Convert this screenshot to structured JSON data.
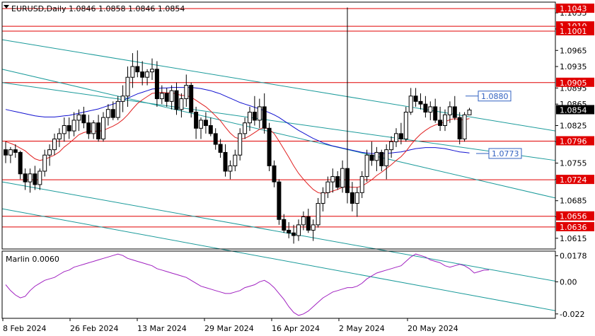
{
  "header": {
    "symbol": "EURUSD,Daily",
    "ohlc": "1.0846 1.0858 1.0846 1.0854"
  },
  "chart_data": [
    {
      "type": "candlestick",
      "title": "EURUSD,Daily  1.0846 1.0858 1.0846 1.0854",
      "x_tick_labels": [
        "8 Feb 2024",
        "26 Feb 2024",
        "13 Mar 2024",
        "29 Mar 2024",
        "16 Apr 2024",
        "2 May 2024",
        "20 May 2024"
      ],
      "y_tick_labels": [
        "1.0615",
        "1.0655",
        "1.0685",
        "1.0725",
        "1.0755",
        "1.0795",
        "1.0825",
        "1.0865",
        "1.0895",
        "1.0935",
        "1.0965",
        "1.1005",
        "1.1035"
      ],
      "ylim": [
        1.0595,
        1.1055
      ],
      "current_price": 1.0854,
      "horizontal_levels": [
        {
          "value": 1.1043,
          "label": "1.1043"
        },
        {
          "value": 1.101,
          "label": "1.1010"
        },
        {
          "value": 1.1001,
          "label": "1.1001"
        },
        {
          "value": 1.0905,
          "label": "1.0905"
        },
        {
          "value": 1.0796,
          "label": "1.0796"
        },
        {
          "value": 1.0724,
          "label": "1.0724"
        },
        {
          "value": 1.0656,
          "label": "1.0656"
        },
        {
          "value": 1.0636,
          "label": "1.0636"
        }
      ],
      "annotations": [
        {
          "value": 1.088,
          "label": "1.0880"
        },
        {
          "value": 1.0773,
          "label": "1.0773"
        }
      ],
      "colors": {
        "level": "#e00000",
        "channel": "#1a9a9a",
        "ma_fast": "#e02020",
        "ma_slow": "#1010d0",
        "oscillator": "#a020c0",
        "label_box": "#3060c0"
      },
      "candles": [
        [
          1.078,
          1.0795,
          1.0755,
          1.077
        ],
        [
          1.077,
          1.0785,
          1.0755,
          1.078
        ],
        [
          1.078,
          1.079,
          1.0765,
          1.0775
        ],
        [
          1.0775,
          1.0778,
          1.0725,
          1.0735
        ],
        [
          1.0735,
          1.0745,
          1.0705,
          1.072
        ],
        [
          1.072,
          1.0745,
          1.07,
          1.0735
        ],
        [
          1.0735,
          1.075,
          1.0705,
          1.0715
        ],
        [
          1.0715,
          1.0745,
          1.0705,
          1.074
        ],
        [
          1.074,
          1.078,
          1.073,
          1.077
        ],
        [
          1.077,
          1.079,
          1.075,
          1.078
        ],
        [
          1.078,
          1.081,
          1.077,
          1.08
        ],
        [
          1.08,
          1.082,
          1.0785,
          1.081
        ],
        [
          1.081,
          1.084,
          1.0795,
          1.0825
        ],
        [
          1.0825,
          1.084,
          1.08,
          1.0815
        ],
        [
          1.0815,
          1.085,
          1.0805,
          1.0835
        ],
        [
          1.0835,
          1.0855,
          1.0815,
          1.0845
        ],
        [
          1.0845,
          1.086,
          1.082,
          1.083
        ],
        [
          1.083,
          1.0845,
          1.08,
          1.081
        ],
        [
          1.081,
          1.0835,
          1.08,
          1.083
        ],
        [
          1.083,
          1.0845,
          1.0795,
          1.08
        ],
        [
          1.08,
          1.085,
          1.0795,
          1.084
        ],
        [
          1.084,
          1.0865,
          1.0825,
          1.0855
        ],
        [
          1.0855,
          1.087,
          1.0835,
          1.084
        ],
        [
          1.084,
          1.088,
          1.0835,
          1.087
        ],
        [
          1.087,
          1.09,
          1.085,
          1.088
        ],
        [
          1.088,
          1.0935,
          1.086,
          1.0915
        ],
        [
          1.0915,
          1.096,
          1.0895,
          1.0935
        ],
        [
          1.0935,
          1.0965,
          1.0915,
          1.0925
        ],
        [
          1.0925,
          1.0945,
          1.09,
          1.0915
        ],
        [
          1.0915,
          1.093,
          1.09,
          1.0925
        ],
        [
          1.0925,
          1.095,
          1.091,
          1.093
        ],
        [
          1.093,
          1.0945,
          1.086,
          1.0875
        ],
        [
          1.0875,
          1.09,
          1.0865,
          1.0885
        ],
        [
          1.0885,
          1.0895,
          1.086,
          1.087
        ],
        [
          1.087,
          1.09,
          1.0855,
          1.089
        ],
        [
          1.089,
          1.0905,
          1.0845,
          1.0855
        ],
        [
          1.0855,
          1.0885,
          1.084,
          1.0875
        ],
        [
          1.0875,
          1.092,
          1.086,
          1.09
        ],
        [
          1.09,
          1.0905,
          1.084,
          1.085
        ],
        [
          1.085,
          1.086,
          1.08,
          1.082
        ],
        [
          1.082,
          1.084,
          1.08,
          1.0835
        ],
        [
          1.0835,
          1.085,
          1.081,
          1.0825
        ],
        [
          1.0825,
          1.084,
          1.0805,
          1.081
        ],
        [
          1.081,
          1.082,
          1.078,
          1.079
        ],
        [
          1.079,
          1.08,
          1.0765,
          1.0775
        ],
        [
          1.0775,
          1.079,
          1.073,
          1.074
        ],
        [
          1.074,
          1.076,
          1.0725,
          1.075
        ],
        [
          1.075,
          1.078,
          1.074,
          1.077
        ],
        [
          1.077,
          1.082,
          1.076,
          1.081
        ],
        [
          1.081,
          1.084,
          1.08,
          1.083
        ],
        [
          1.083,
          1.086,
          1.0815,
          1.085
        ],
        [
          1.085,
          1.088,
          1.0825,
          1.0835
        ],
        [
          1.0835,
          1.0875,
          1.082,
          1.086
        ],
        [
          1.086,
          1.0885,
          1.081,
          1.082
        ],
        [
          1.082,
          1.083,
          1.074,
          1.075
        ],
        [
          1.075,
          1.076,
          1.071,
          1.072
        ],
        [
          1.072,
          1.0725,
          1.064,
          1.065
        ],
        [
          1.065,
          1.066,
          1.0625,
          1.063
        ],
        [
          1.063,
          1.0645,
          1.0615,
          1.0625
        ],
        [
          1.0625,
          1.064,
          1.0605,
          1.062
        ],
        [
          1.062,
          1.065,
          1.061,
          1.064
        ],
        [
          1.064,
          1.0665,
          1.063,
          1.0655
        ],
        [
          1.0655,
          1.067,
          1.0625,
          1.063
        ],
        [
          1.063,
          1.065,
          1.061,
          1.064
        ],
        [
          1.064,
          1.069,
          1.0635,
          1.068
        ],
        [
          1.068,
          1.071,
          1.0665,
          1.07
        ],
        [
          1.07,
          1.073,
          1.069,
          1.072
        ],
        [
          1.072,
          1.0745,
          1.07,
          1.073
        ],
        [
          1.073,
          1.074,
          1.0705,
          1.071
        ],
        [
          1.071,
          1.076,
          1.07,
          1.0745
        ],
        [
          1.0745,
          1.1045,
          1.068,
          1.07
        ],
        [
          1.07,
          1.072,
          1.0665,
          1.068
        ],
        [
          1.068,
          1.071,
          1.0655,
          1.07
        ],
        [
          1.07,
          1.074,
          1.069,
          1.073
        ],
        [
          1.073,
          1.078,
          1.072,
          1.077
        ],
        [
          1.077,
          1.0795,
          1.075,
          1.076
        ],
        [
          1.076,
          1.0785,
          1.074,
          1.0775
        ],
        [
          1.0775,
          1.078,
          1.074,
          1.075
        ],
        [
          1.075,
          1.079,
          1.0725,
          1.078
        ],
        [
          1.078,
          1.0805,
          1.0765,
          1.0795
        ],
        [
          1.0795,
          1.082,
          1.0785,
          1.081
        ],
        [
          1.081,
          1.083,
          1.079,
          1.08
        ],
        [
          1.08,
          1.086,
          1.0795,
          1.085
        ],
        [
          1.085,
          1.0895,
          1.0845,
          1.088
        ],
        [
          1.088,
          1.0895,
          1.086,
          1.087
        ],
        [
          1.087,
          1.0885,
          1.0855,
          1.0865
        ],
        [
          1.0865,
          1.088,
          1.084,
          1.085
        ],
        [
          1.085,
          1.087,
          1.0835,
          1.086
        ],
        [
          1.086,
          1.0875,
          1.083,
          1.0835
        ],
        [
          1.0835,
          1.086,
          1.0815,
          1.0825
        ],
        [
          1.0825,
          1.0855,
          1.0815,
          1.0845
        ],
        [
          1.0845,
          1.087,
          1.083,
          1.086
        ],
        [
          1.086,
          1.088,
          1.0835,
          1.084
        ],
        [
          1.084,
          1.085,
          1.079,
          1.08
        ],
        [
          1.08,
          1.085,
          1.0795,
          1.0845
        ],
        [
          1.0845,
          1.0858,
          1.0846,
          1.0854
        ]
      ],
      "moving_average_fast": [
        1.0795,
        1.0792,
        1.0788,
        1.0783,
        1.0778,
        1.077,
        1.0763,
        1.076,
        1.0762,
        1.0766,
        1.077,
        1.0776,
        1.0785,
        1.0792,
        1.08,
        1.0808,
        1.0812,
        1.0814,
        1.0815,
        1.0814,
        1.0816,
        1.082,
        1.0824,
        1.0829,
        1.0836,
        1.0845,
        1.0856,
        1.0866,
        1.0873,
        1.0879,
        1.0885,
        1.0886,
        1.0887,
        1.0886,
        1.0886,
        1.0884,
        1.0881,
        1.0881,
        1.0878,
        1.0872,
        1.0866,
        1.086,
        1.0852,
        1.0843,
        1.0834,
        1.0822,
        1.0811,
        1.0803,
        1.08,
        1.0801,
        1.0806,
        1.0812,
        1.0818,
        1.0822,
        1.0818,
        1.081,
        1.0796,
        1.0781,
        1.0766,
        1.075,
        1.0736,
        1.0725,
        1.0715,
        1.0706,
        1.07,
        1.0698,
        1.07,
        1.0703,
        1.0706,
        1.071,
        1.0711,
        1.071,
        1.071,
        1.0712,
        1.0718,
        1.0724,
        1.0732,
        1.0738,
        1.0745,
        1.0752,
        1.076,
        1.0767,
        1.0777,
        1.0789,
        1.08,
        1.0809,
        1.0816,
        1.0822,
        1.0826,
        1.0829,
        1.0832,
        1.0836,
        1.0838,
        1.0836,
        1.0836,
        1.0838
      ],
      "moving_average_slow": [
        1.0855,
        1.0853,
        1.0851,
        1.0849,
        1.0847,
        1.0845,
        1.0843,
        1.0842,
        1.0841,
        1.0841,
        1.0841,
        1.0842,
        1.0843,
        1.0844,
        1.0846,
        1.0848,
        1.085,
        1.0852,
        1.0854,
        1.0856,
        1.0859,
        1.0862,
        1.0865,
        1.0868,
        1.0872,
        1.0876,
        1.088,
        1.0884,
        1.0887,
        1.089,
        1.0893,
        1.0894,
        1.0895,
        1.0895,
        1.0896,
        1.0896,
        1.0896,
        1.0896,
        1.0896,
        1.0895,
        1.0894,
        1.0892,
        1.089,
        1.0887,
        1.0884,
        1.088,
        1.0876,
        1.0872,
        1.0868,
        1.0865,
        1.0862,
        1.0859,
        1.0856,
        1.0853,
        1.0849,
        1.0845,
        1.084,
        1.0834,
        1.0828,
        1.0822,
        1.0816,
        1.0811,
        1.0806,
        1.0801,
        1.0797,
        1.0793,
        1.079,
        1.0787,
        1.0785,
        1.0783,
        1.0781,
        1.0779,
        1.0777,
        1.0775,
        1.0774,
        1.0773,
        1.0773,
        1.0773,
        1.0773,
        1.0774,
        1.0775,
        1.0776,
        1.0778,
        1.078,
        1.0782,
        1.0783,
        1.0784,
        1.0784,
        1.0784,
        1.0783,
        1.0782,
        1.078,
        1.0778,
        1.0776,
        1.0775,
        1.0774
      ],
      "channel_lines": [
        [
          1.0985,
          1.0815
        ],
        [
          1.093,
          1.069
        ],
        [
          1.0905,
          1.076
        ],
        [
          1.072,
          1.0535
        ],
        [
          1.067,
          1.048
        ]
      ]
    },
    {
      "type": "line",
      "title": "Marlin 0.0060",
      "y_tick_labels": [
        "0.0178",
        "0.00",
        "-0.022"
      ],
      "ylim": [
        -0.025,
        0.021
      ],
      "series": [
        {
          "name": "Marlin",
          "values": [
            -0.002,
            -0.006,
            -0.009,
            -0.011,
            -0.01,
            -0.006,
            -0.003,
            -0.001,
            0.001,
            0.002,
            0.003,
            0.005,
            0.007,
            0.008,
            0.01,
            0.011,
            0.012,
            0.013,
            0.014,
            0.015,
            0.016,
            0.017,
            0.018,
            0.019,
            0.018,
            0.016,
            0.015,
            0.014,
            0.013,
            0.012,
            0.011,
            0.009,
            0.008,
            0.007,
            0.006,
            0.005,
            0.004,
            0.003,
            0.001,
            -0.001,
            -0.003,
            -0.004,
            -0.005,
            -0.006,
            -0.007,
            -0.008,
            -0.008,
            -0.007,
            -0.006,
            -0.004,
            -0.003,
            -0.002,
            0.0,
            0.001,
            -0.001,
            -0.004,
            -0.008,
            -0.012,
            -0.017,
            -0.021,
            -0.023,
            -0.022,
            -0.02,
            -0.017,
            -0.014,
            -0.011,
            -0.009,
            -0.007,
            -0.006,
            -0.005,
            -0.004,
            -0.004,
            -0.003,
            -0.001,
            0.002,
            0.004,
            0.006,
            0.007,
            0.008,
            0.009,
            0.01,
            0.011,
            0.014,
            0.017,
            0.019,
            0.018,
            0.017,
            0.015,
            0.014,
            0.013,
            0.011,
            0.01,
            0.011,
            0.012,
            0.011,
            0.009,
            0.006,
            0.007,
            0.008,
            0.008
          ]
        }
      ]
    }
  ]
}
